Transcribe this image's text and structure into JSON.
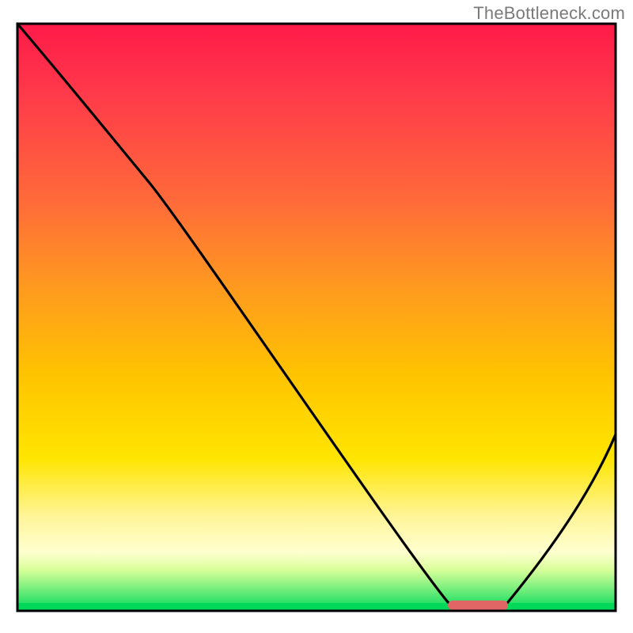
{
  "watermark": "TheBottleneck.com",
  "chart_data": {
    "type": "line",
    "title": "",
    "xlabel": "",
    "ylabel": "",
    "xlim": [
      0,
      100
    ],
    "ylim": [
      0,
      100
    ],
    "series": [
      {
        "name": "bottleneck-curve",
        "x": [
          0,
          22,
          72,
          78,
          82,
          100
        ],
        "values": [
          100,
          73,
          1.5,
          0.7,
          1.5,
          30
        ],
        "note": "Values are estimated relative heights read from the plot; y=0 is the bottom green baseline, y=100 is the top. The curve descends steeply from top-left, has an inflection around x≈22, reaches a flat minimum around x≈72–82, then rises toward the right edge."
      }
    ],
    "marker": {
      "name": "optimum-marker",
      "x_start": 72,
      "x_end": 82,
      "y": 0.7,
      "color": "#e06666",
      "note": "The short salmon/pink horizontal bar at the valley floor."
    },
    "background_gradient": {
      "top_color": "#ff1744",
      "orange": "#ff8a00",
      "yellow": "#ffe500",
      "pale_yellow": "#ffffb0",
      "bottom_color": "#00e060",
      "note": "Vertical gradient from red (top) through orange and yellow to green (bottom)."
    },
    "frame_color": "#000000"
  }
}
